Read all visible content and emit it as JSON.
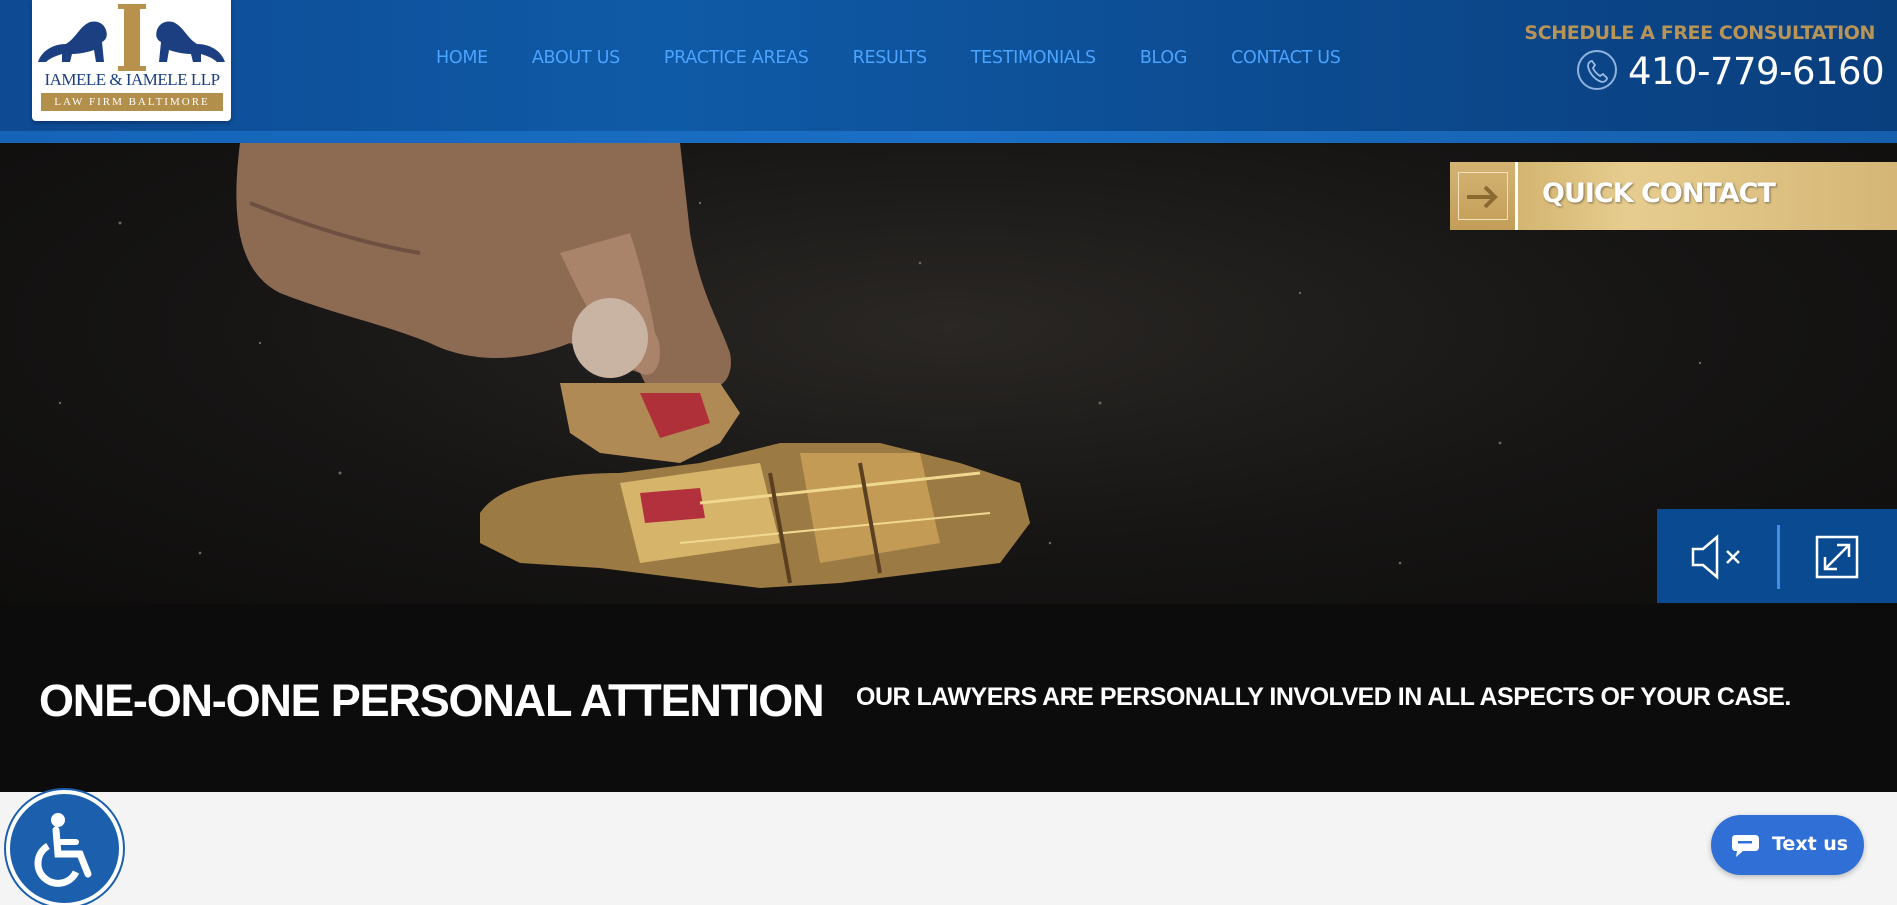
{
  "header": {
    "logo": {
      "firm_name": "IAMELE & IAMELE LLP",
      "tagline": "LAW FIRM BALTIMORE",
      "icon": "lions-column-logo"
    },
    "nav": [
      {
        "label": "HOME"
      },
      {
        "label": "ABOUT US"
      },
      {
        "label": "PRACTICE AREAS"
      },
      {
        "label": "RESULTS"
      },
      {
        "label": "TESTIMONIALS"
      },
      {
        "label": "BLOG"
      },
      {
        "label": "CONTACT US"
      }
    ],
    "consultation_label": "SCHEDULE A FREE CONSULTATION",
    "phone": "410-779-6160",
    "phone_icon": "phone-icon"
  },
  "hero": {
    "quick_contact_label": "QUICK CONTACT",
    "quick_contact_icon": "arrow-right-icon",
    "media": {
      "mute_icon": "speaker-muted-icon",
      "fullscreen_icon": "expand-icon"
    },
    "caption_title": "ONE-ON-ONE PERSONAL ATTENTION",
    "caption_subtitle": "OUR LAWYERS ARE PERSONALLY INVOLVED IN ALL ASPECTS OF YOUR CASE."
  },
  "widgets": {
    "accessibility_icon": "wheelchair-icon",
    "text_us_label": "Text us",
    "text_us_icon": "chat-bubble-icon"
  },
  "colors": {
    "header_blue": "#0f5aa6",
    "nav_link": "#4aa3ff",
    "gold": "#b89457",
    "accent_blue": "#2f6fd6"
  }
}
